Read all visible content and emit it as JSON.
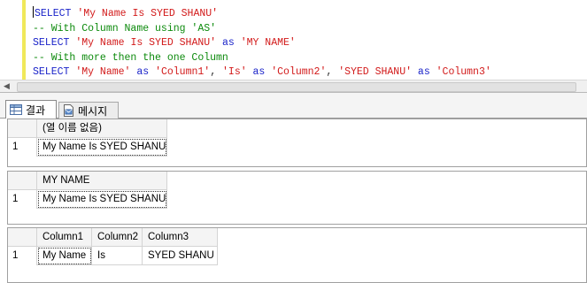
{
  "editor": {
    "lines": [
      [
        {
          "t": "kw",
          "v": "SELECT"
        },
        {
          "t": "pl",
          "v": " "
        },
        {
          "t": "str",
          "v": "'My Name Is SYED SHANU'"
        }
      ],
      [
        {
          "t": "cm",
          "v": "-- With Column Name using 'AS'"
        }
      ],
      [
        {
          "t": "kw",
          "v": "SELECT"
        },
        {
          "t": "pl",
          "v": " "
        },
        {
          "t": "str",
          "v": "'My Name Is SYED SHANU'"
        },
        {
          "t": "pl",
          "v": " "
        },
        {
          "t": "kw",
          "v": "as"
        },
        {
          "t": "pl",
          "v": " "
        },
        {
          "t": "str",
          "v": "'MY NAME'"
        }
      ],
      [
        {
          "t": "cm",
          "v": "-- With more then the one Column"
        }
      ],
      [
        {
          "t": "kw",
          "v": "SELECT"
        },
        {
          "t": "pl",
          "v": " "
        },
        {
          "t": "str",
          "v": "'My Name'"
        },
        {
          "t": "pl",
          "v": " "
        },
        {
          "t": "kw",
          "v": "as"
        },
        {
          "t": "pl",
          "v": " "
        },
        {
          "t": "str",
          "v": "'Column1'"
        },
        {
          "t": "pl",
          "v": ", "
        },
        {
          "t": "str",
          "v": "'Is'"
        },
        {
          "t": "pl",
          "v": " "
        },
        {
          "t": "kw",
          "v": "as"
        },
        {
          "t": "pl",
          "v": " "
        },
        {
          "t": "str",
          "v": "'Column2'"
        },
        {
          "t": "pl",
          "v": ", "
        },
        {
          "t": "str",
          "v": "'SYED SHANU'"
        },
        {
          "t": "pl",
          "v": " "
        },
        {
          "t": "kw",
          "v": "as"
        },
        {
          "t": "pl",
          "v": " "
        },
        {
          "t": "str",
          "v": "'Column3'"
        }
      ]
    ],
    "colors": {
      "keyword": "#1a23c9",
      "string": "#d21a1a",
      "comment": "#0c8a0c"
    }
  },
  "tabs": {
    "results_label": "결과",
    "messages_label": "메시지",
    "results_icon": "grid-icon",
    "messages_icon": "message-doc-icon"
  },
  "results": {
    "grid1": {
      "headers": [
        "(열 이름 없음)"
      ],
      "rows": [
        {
          "num": "1",
          "cells": [
            "My Name Is SYED SHANU"
          ]
        }
      ]
    },
    "grid2": {
      "headers": [
        "MY NAME"
      ],
      "rows": [
        {
          "num": "1",
          "cells": [
            "My Name Is SYED SHANU"
          ]
        }
      ]
    },
    "grid3": {
      "headers": [
        "Column1",
        "Column2",
        "Column3"
      ],
      "rows": [
        {
          "num": "1",
          "cells": [
            "My Name",
            "Is",
            "SYED SHANU"
          ]
        }
      ]
    }
  }
}
